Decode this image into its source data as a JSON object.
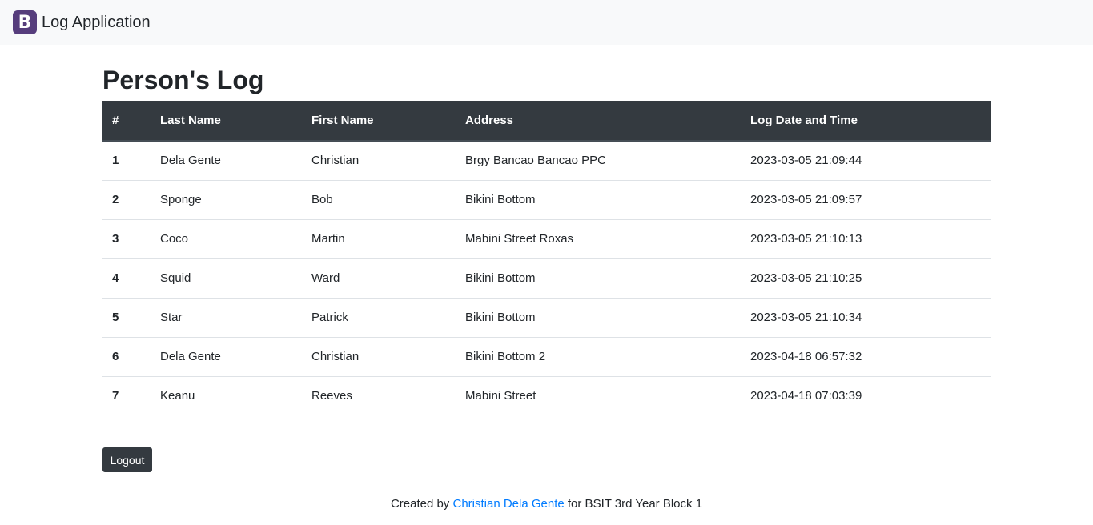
{
  "navbar": {
    "logo_letter": "B",
    "brand_text": "Log Application"
  },
  "page": {
    "title": "Person's Log"
  },
  "table": {
    "headers": [
      "#",
      "Last Name",
      "First Name",
      "Address",
      "Log Date and Time"
    ],
    "rows": [
      [
        "1",
        "Dela Gente",
        "Christian",
        "Brgy Bancao Bancao PPC",
        "2023-03-05 21:09:44"
      ],
      [
        "2",
        "Sponge",
        "Bob",
        "Bikini Bottom",
        "2023-03-05 21:09:57"
      ],
      [
        "3",
        "Coco",
        "Martin",
        "Mabini Street Roxas",
        "2023-03-05 21:10:13"
      ],
      [
        "4",
        "Squid",
        "Ward",
        "Bikini Bottom",
        "2023-03-05 21:10:25"
      ],
      [
        "5",
        "Star",
        "Patrick",
        "Bikini Bottom",
        "2023-03-05 21:10:34"
      ],
      [
        "6",
        "Dela Gente",
        "Christian",
        "Bikini Bottom 2",
        "2023-04-18 06:57:32"
      ],
      [
        "7",
        "Keanu",
        "Reeves",
        "Mabini Street",
        "2023-04-18 07:03:39"
      ]
    ]
  },
  "actions": {
    "logout_label": "Logout"
  },
  "footer": {
    "prefix": "Created by ",
    "link_text": "Christian Dela Gente",
    "suffix": " for BSIT 3rd Year Block 1"
  },
  "colors": {
    "brand_purple": "#563d7c",
    "dark": "#343a40",
    "link": "#007bff",
    "navbar_bg": "#f8f9fa"
  }
}
